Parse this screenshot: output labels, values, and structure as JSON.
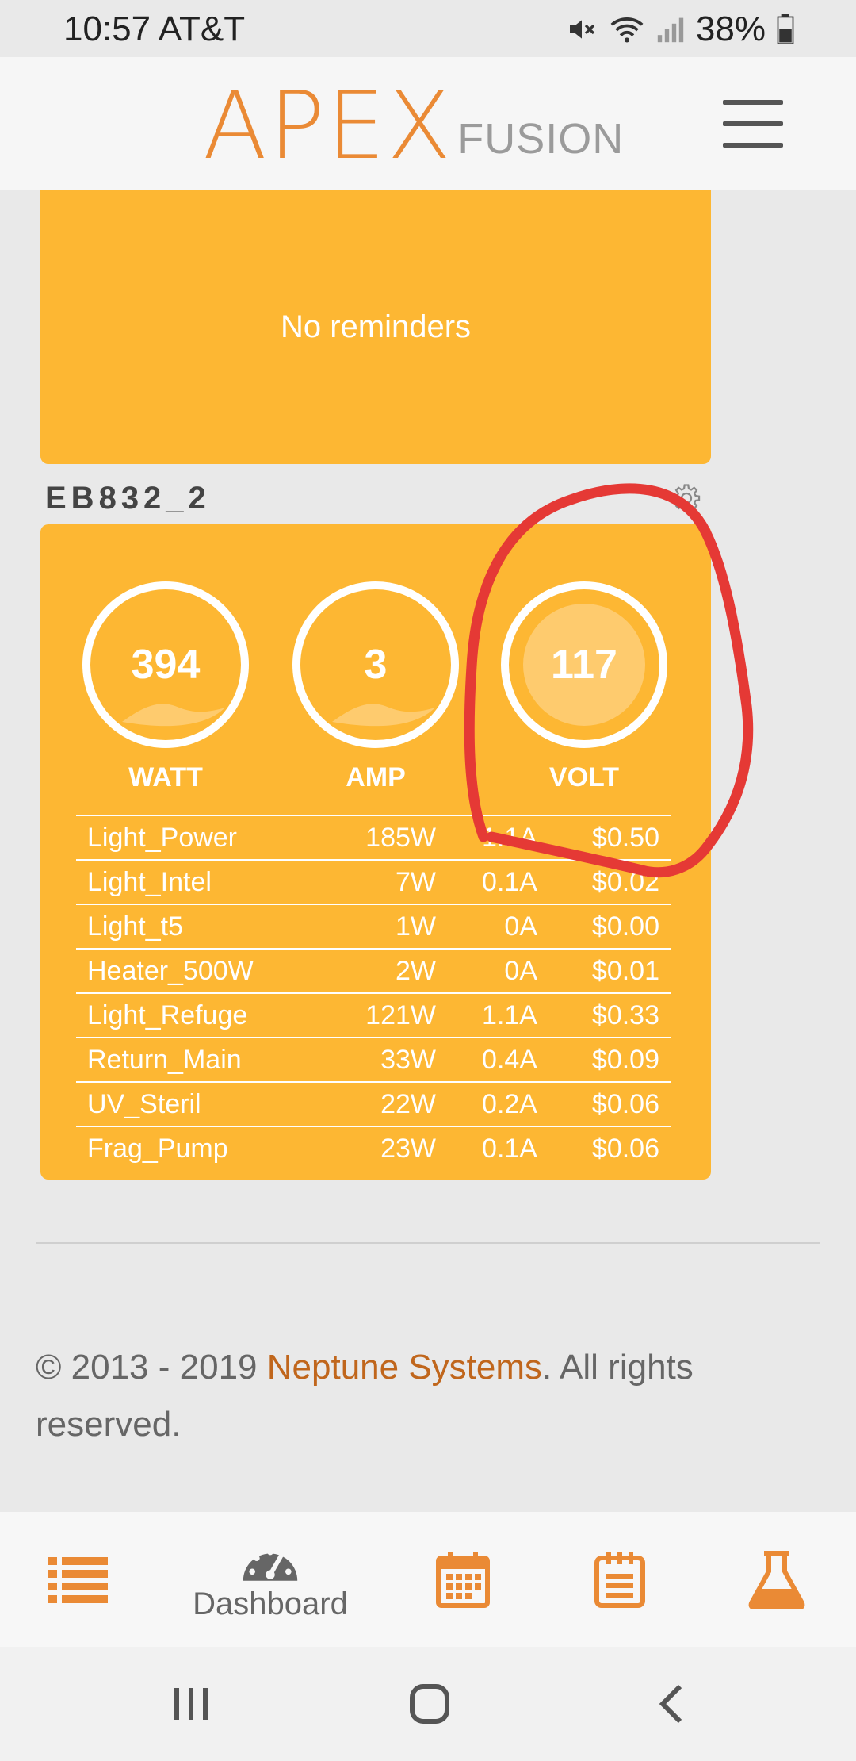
{
  "status_bar": {
    "time_carrier": "10:57 AT&T",
    "battery": "38%",
    "icons": [
      "mute-icon",
      "wifi-icon",
      "signal-icon",
      "battery-icon"
    ]
  },
  "header": {
    "logo_primary": "APEX",
    "logo_secondary": "FUSION",
    "menu_icon": "hamburger-menu-icon"
  },
  "reminders": {
    "empty_text": "No reminders"
  },
  "energy_bar": {
    "title": "EB832_2",
    "gauges": [
      {
        "value": "394",
        "label": "WATT"
      },
      {
        "value": "3",
        "label": "AMP"
      },
      {
        "value": "117",
        "label": "VOLT"
      }
    ],
    "outlets": [
      {
        "name": "Light_Power",
        "watts": "185W",
        "amps": "1.1A",
        "cost": "$0.50"
      },
      {
        "name": "Light_Intel",
        "watts": "7W",
        "amps": "0.1A",
        "cost": "$0.02"
      },
      {
        "name": "Light_t5",
        "watts": "1W",
        "amps": "0A",
        "cost": "$0.00"
      },
      {
        "name": "Heater_500W",
        "watts": "2W",
        "amps": "0A",
        "cost": "$0.01"
      },
      {
        "name": "Light_Refuge",
        "watts": "121W",
        "amps": "1.1A",
        "cost": "$0.33"
      },
      {
        "name": "Return_Main",
        "watts": "33W",
        "amps": "0.4A",
        "cost": "$0.09"
      },
      {
        "name": "UV_Steril",
        "watts": "22W",
        "amps": "0.2A",
        "cost": "$0.06"
      },
      {
        "name": "Frag_Pump",
        "watts": "23W",
        "amps": "0.1A",
        "cost": "$0.06"
      }
    ]
  },
  "footer": {
    "copyright_prefix": "© 2013 - 2019 ",
    "brand": "Neptune Systems",
    "copyright_suffix": ". All rights reserved."
  },
  "bottom_nav": {
    "dashboard_label": "Dashboard"
  },
  "colors": {
    "accent_orange": "#ea8a35",
    "card_yellow": "#fdb733",
    "annotation_red": "#e53935"
  }
}
